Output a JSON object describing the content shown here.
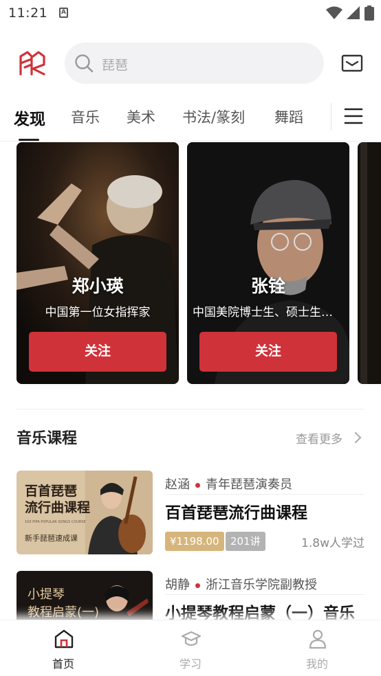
{
  "status_bar": {
    "time": "11:21",
    "notification_badge": "A"
  },
  "header": {
    "search_placeholder": "琵琶"
  },
  "tabs": [
    {
      "label": "发现",
      "active": true
    },
    {
      "label": "音乐",
      "active": false
    },
    {
      "label": "美术",
      "active": false
    },
    {
      "label": "书法/篆刻",
      "active": false
    },
    {
      "label": "舞蹈",
      "active": false
    }
  ],
  "creators": [
    {
      "name": "郑小瑛",
      "desc": "中国第一位女指挥家",
      "follow_label": "关注"
    },
    {
      "name": "张铨",
      "desc": "中国美院博士生、硕士生导师",
      "follow_label": "关注"
    }
  ],
  "music_section": {
    "title": "音乐课程",
    "see_more": "查看更多"
  },
  "courses": [
    {
      "teacher": "赵涵",
      "teacher_title": "青年琵琶演奏员",
      "title": "百首琵琶流行曲课程",
      "price": "¥1198.00",
      "lessons": "201讲",
      "learners": "1.8w人学过",
      "thumb_line1": "百首琵琶",
      "thumb_line2": "流行曲课程",
      "thumb_sub": "100 PIPA POPULAR SONGS COURSE",
      "thumb_tag": "新手琵琶速成课"
    },
    {
      "teacher": "胡静",
      "teacher_title": "浙江音乐学院副教授",
      "title": "小提琴教程启蒙（一）音乐",
      "thumb_line1": "小提琴",
      "thumb_line2": "教程启蒙(一)"
    }
  ],
  "bottom_nav": [
    {
      "label": "首页",
      "icon": "home-icon",
      "active": true
    },
    {
      "label": "学习",
      "icon": "graduation-cap-icon",
      "active": false
    },
    {
      "label": "我的",
      "icon": "person-icon",
      "active": false
    }
  ],
  "colors": {
    "accent": "#cf3239",
    "price_bg": "#d6b57c",
    "lessons_bg": "#b3b3b3"
  }
}
